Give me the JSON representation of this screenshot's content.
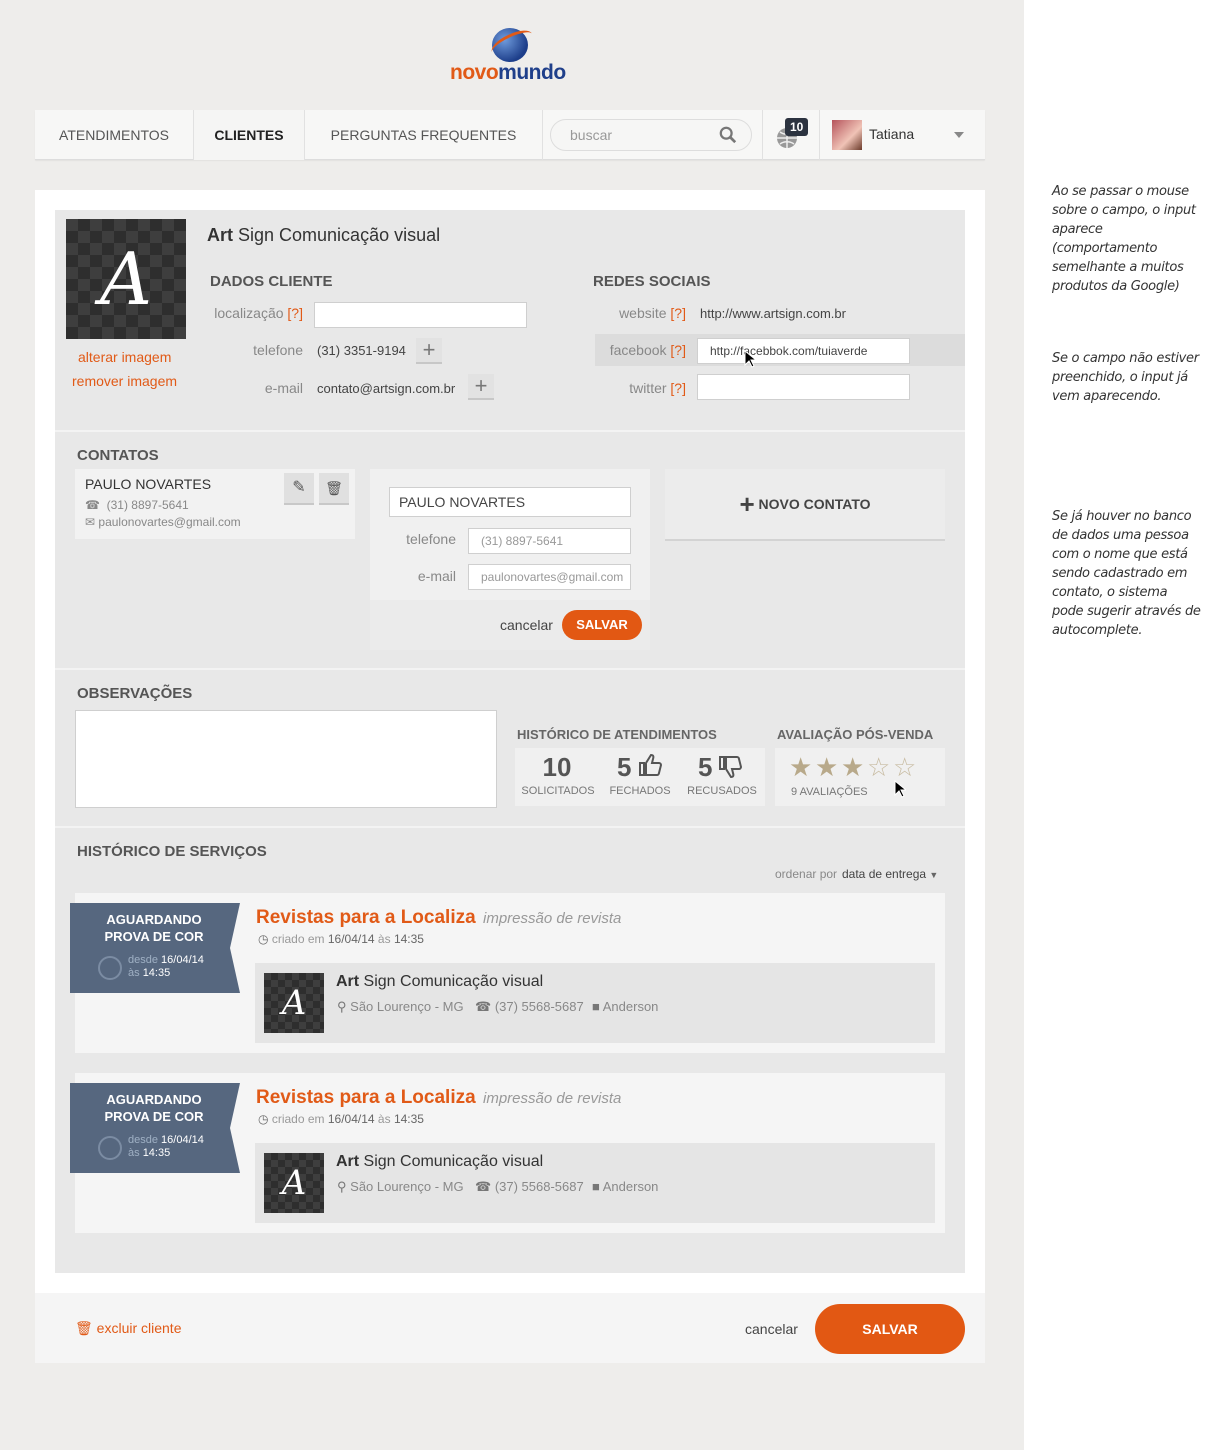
{
  "logo": {
    "part1": "novo",
    "part2": "mundo"
  },
  "nav": {
    "items": [
      "ATENDIMENTOS",
      "CLIENTES",
      "PERGUNTAS FREQUENTES"
    ],
    "search_placeholder": "buscar",
    "notifications_count": "10",
    "user_name": "Tatiana"
  },
  "client": {
    "name_bold": "Art",
    "name_rest": " Sign Comunicação visual",
    "avatar_letter": "A",
    "change_image": "alterar imagem",
    "remove_image": "remover imagem"
  },
  "dados": {
    "title": "DADOS CLIENTE",
    "location_label": "localização",
    "help": "[?]",
    "location_value": "",
    "phone_label": "telefone",
    "phone_value": "(31) 3351-9194",
    "email_label": "e-mail",
    "email_value": "contato@artsign.com.br",
    "add": "+"
  },
  "social": {
    "title": "REDES SOCIAIS",
    "website_label": "website",
    "website_value": "http://www.artsign.com.br",
    "facebook_label": "facebook",
    "facebook_value": "http://facebbok.com/tuiaverde",
    "twitter_label": "twitter",
    "twitter_value": ""
  },
  "contacts": {
    "title": "CONTATOS",
    "card": {
      "name": "PAULO NOVARTES",
      "phone": "(31) 8897-5641",
      "email": "paulonovartes@gmail.com"
    },
    "form": {
      "name_value": "PAULO NOVARTES",
      "phone_label": "telefone",
      "phone_placeholder": "(31) 8897-5641",
      "email_label": "e-mail",
      "email_placeholder": "paulonovartes@gmail.com",
      "cancel": "cancelar",
      "save": "SALVAR"
    },
    "new_contact": "NOVO CONTATO"
  },
  "observations": {
    "title": "OBSERVAÇÕES",
    "value": ""
  },
  "history": {
    "title": "HISTÓRICO DE ATENDIMENTOS",
    "stats": [
      {
        "value": "10",
        "label": "SOLICITADOS"
      },
      {
        "value": "5",
        "label": "FECHADOS"
      },
      {
        "value": "5",
        "label": "RECUSADOS"
      }
    ]
  },
  "rating": {
    "title": "AVALIAÇÃO PÓS-VENDA",
    "stars": 3,
    "max": 5,
    "count_label": "9 AVALIAÇÕES",
    "filled_color": "#b8a98a",
    "empty_color": "#c8bca2"
  },
  "services": {
    "title": "HISTÓRICO DE SERVIÇOS",
    "sort_label": "ordenar por",
    "sort_value": "data de entrega",
    "items": [
      {
        "status_line1": "AGUARDANDO",
        "status_line2": "PROVA DE COR",
        "since_label": "desde",
        "since_date": "16/04/14",
        "at_label": "às",
        "since_time": "14:35",
        "title": "Revistas para a Localiza",
        "subtitle": "impressão de revista",
        "created_label": "criado em",
        "created_date": "16/04/14",
        "created_at": "às",
        "created_time": "14:35",
        "client_bold": "Art",
        "client_rest": " Sign Comunicação visual",
        "location": "São Lourenço - MG",
        "phone": "(37) 5568-5687",
        "person": "Anderson"
      },
      {
        "status_line1": "AGUARDANDO",
        "status_line2": "PROVA DE COR",
        "since_label": "desde",
        "since_date": "16/04/14",
        "at_label": "às",
        "since_time": "14:35",
        "title": "Revistas para a Localiza",
        "subtitle": "impressão de revista",
        "created_label": "criado em",
        "created_date": "16/04/14",
        "created_at": "às",
        "created_time": "14:35",
        "client_bold": "Art",
        "client_rest": " Sign Comunicação visual",
        "location": "São Lourenço - MG",
        "phone": "(37) 5568-5687",
        "person": "Anderson"
      }
    ]
  },
  "footer": {
    "delete": "excluir cliente",
    "cancel": "cancelar",
    "save": "SALVAR"
  },
  "notes": [
    "Ao se passar o mouse sobre o campo, o input aparece (comportamento semelhante a muitos produtos da Google)",
    "Se o campo não estiver preenchido, o input já vem aparecendo.",
    "Se já houver no banco de dados uma pessoa com o nome que está sendo cadastrado em contato, o sistema pode sugerir através de autocomplete."
  ],
  "colors": {
    "accent": "#e15a17",
    "brand_blue": "#1f3f8a",
    "ribbon": "#56677f"
  }
}
